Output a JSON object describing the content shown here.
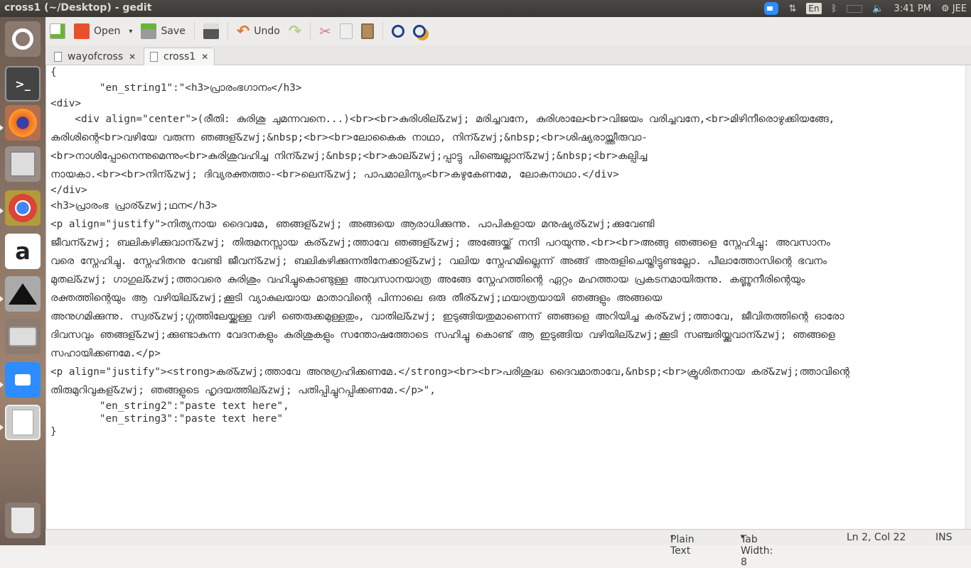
{
  "window": {
    "title": "cross1 (~/Desktop) - gedit"
  },
  "tray": {
    "language": "En",
    "time": "3:41 PM",
    "user": "JEE"
  },
  "launcher": [
    "ubuntu-dash",
    "terminal",
    "firefox",
    "files",
    "chrome",
    "amazon",
    "inkscape",
    "camera",
    "zoom",
    "gedit",
    "trash"
  ],
  "toolbar": {
    "open": "Open",
    "save": "Save",
    "undo": "Undo"
  },
  "tabs": [
    {
      "label": "wayofcross"
    },
    {
      "label": "cross1"
    }
  ],
  "editor": {
    "lines": [
      "{",
      "\t\"en_string1\":\"<h3>പ്രാരംഭഗാനം</h3>",
      "<div>",
      "    <div align=\"center\">(രീതി: കുരിശു ചുമന്നവനെ...)<br><br>കുരിശില്&zwj; മരിച്ചവനേ, കുരിശാലേ<br>വിജയം വരിച്ചവനേ,<br>മിഴിനീരൊഴുക്കിയങ്ങേ,",
      "കുരിശിന്റെ<br>വഴിയേ വരുന്ന ഞങ്ങള്&zwj;&nbsp;<br><br>ലോകൈക നാഥാ, നിന്&zwj;&nbsp;<br>ശിഷ്യരായ്ത്തീരുവാ-",
      "<br>നാശിപ്പോനെന്നുമെന്നും<br>കുരിശുവഹിച്ച നിന്&zwj;&nbsp;<br>കാല്&zwj;പ്പാട്ടു പിഞ്ചെല്ലാന്&zwj;&nbsp;<br>കല്പിച്ച",
      "നായകാ.<br><br>നിന്&zwj; ദിവ്യരക്തത്താ-<br>ലെന്&zwj; പാപമാലിന്യം<br>കഴുകേണമേ, ലോകനാഥാ.</div>",
      "</div>",
      "<h3>പ്രാരംഭ പ്രാര്&zwj;ഥന</h3>",
      "<p align=\"justify\">നിത്യനായ ദൈവമേ, ഞങ്ങള്&zwj; അങ്ങയെ ആരാധിക്കുന്നു. പാപികളായ മനുഷ്യര്&zwj;ക്കുവേണ്ടി",
      "ജീവന്&zwj; ബലികഴിക്കുവാന്&zwj; തിരുമനസ്സായ കര്&zwj;ത്താവേ ഞങ്ങള്&zwj; അങ്ങേയ്ക്ക് നന്ദി പറയുന്നു.<br><br>അങ്ങു ഞങ്ങളെ സ്നേഹിച്ചു: അവസാനം",
      "വരെ സ്നേഹിച്ചു. സ്നേഹിതനു വേണ്ടി ജീവന്&zwj; ബലികഴിക്കുന്നതിനേക്കാള്&zwj; വലിയ സ്നേഹമില്ലെന്ന് അങ്ങ് അരുളിചെയ്തിട്ടുണ്ടല്ലോ. പീലാത്തോസിന്റെ ഭവനം",
      "മുതല്&zwj; ഗാഗുല്&zwj;ത്താവരെ കുരിശും വഹിച്ചുകൊണ്ടുള്ള അവസാനയാത്ര അങ്ങേ സ്നേഹത്തിന്റെ ഏറ്റം മഹത്തായ പ്രകടനമായിരുന്നു. കണ്ണുനീരിന്റെയും",
      "രക്തത്തിന്റെയും ആ വഴിയില്&zwj;ക്കൂടി വ്യാകുലയായ മാതാവിന്റെ പിന്നാലെ ഒരു തീര്&zwj;ഥയാത്രയായി ഞങ്ങളും അങ്ങയെ",
      "അനുഗമിക്കുന്നു. സ്വര്&zwj;ഗ്ഗത്തിലേയ്ക്കുള്ള വഴി ഞെരുക്കമുള്ളതും, വാതില്&zwj; ഇടുങ്ങിയതുമാണെന്ന് ഞങ്ങളെ അറിയിച്ച കര്&zwj;ത്താവേ, ജീവിതത്തിന്റെ ഓരോ",
      "ദിവസവും ഞങ്ങള്&zwj;ക്കുണ്ടാകുന്ന വേദനകളും കുരിശുകളും സന്തോഷത്തോടെ സഹിച്ചു കൊണ്ട് ആ ഇടുങ്ങിയ വഴിയില്&zwj;ക്കൂടി സഞ്ചരിയ്ക്കുവാന്&zwj; ഞങ്ങളെ",
      "സഹായിക്കണമേ.</p>",
      "<p align=\"justify\"><strong>കര്&zwj;ത്താവേ അനുഗ്രഹിക്കണമേ.</strong><br><br>പരിശുദ്ധ ദൈവമാതാവേ,&nbsp;<br>ക്രൂശിതനായ കര്&zwj;ത്താവിന്റെ",
      "തിരുമുറിവുകള്&zwj; ഞങ്ങളുടെ ഹൃദയത്തില്&zwj; പതിപ്പിച്ചുറപ്പിക്കണമേ.</p>\",",
      "\t\"en_string2\":\"paste text here\",",
      "\t\"en_string3\":\"paste text here\"",
      "}"
    ]
  },
  "status": {
    "language": "Plain Text",
    "tab_width": "Tab Width: 8",
    "position": "Ln 2, Col 22",
    "mode": "INS"
  }
}
